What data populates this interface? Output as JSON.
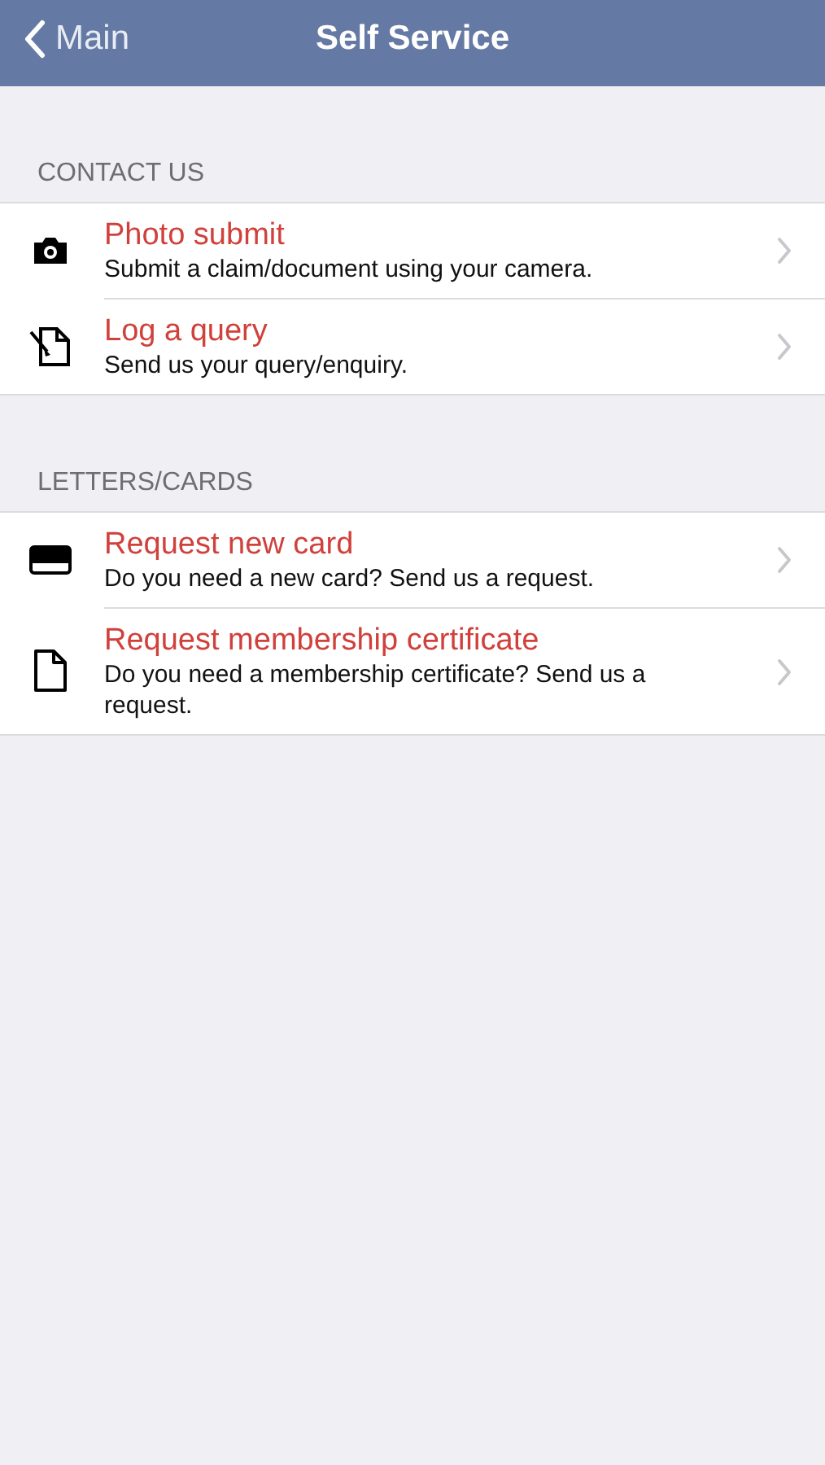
{
  "nav_bar": {
    "back_label": "Main",
    "title": "Self Service"
  },
  "sections": [
    {
      "header": "CONTACT US",
      "items": [
        {
          "kind": "camera",
          "title": "Photo submit",
          "description": "Submit a claim/document using your camera."
        },
        {
          "kind": "query",
          "title": "Log a query",
          "description": "Send us your query/enquiry."
        }
      ]
    },
    {
      "header": "LETTERS/CARDS",
      "items": [
        {
          "kind": "card",
          "title": "Request new card",
          "description": "Do you need a new card? Send us a request."
        },
        {
          "kind": "document",
          "title": "Request membership certificate",
          "description": "Do you need a membership certificate? Send us a request."
        }
      ]
    }
  ]
}
